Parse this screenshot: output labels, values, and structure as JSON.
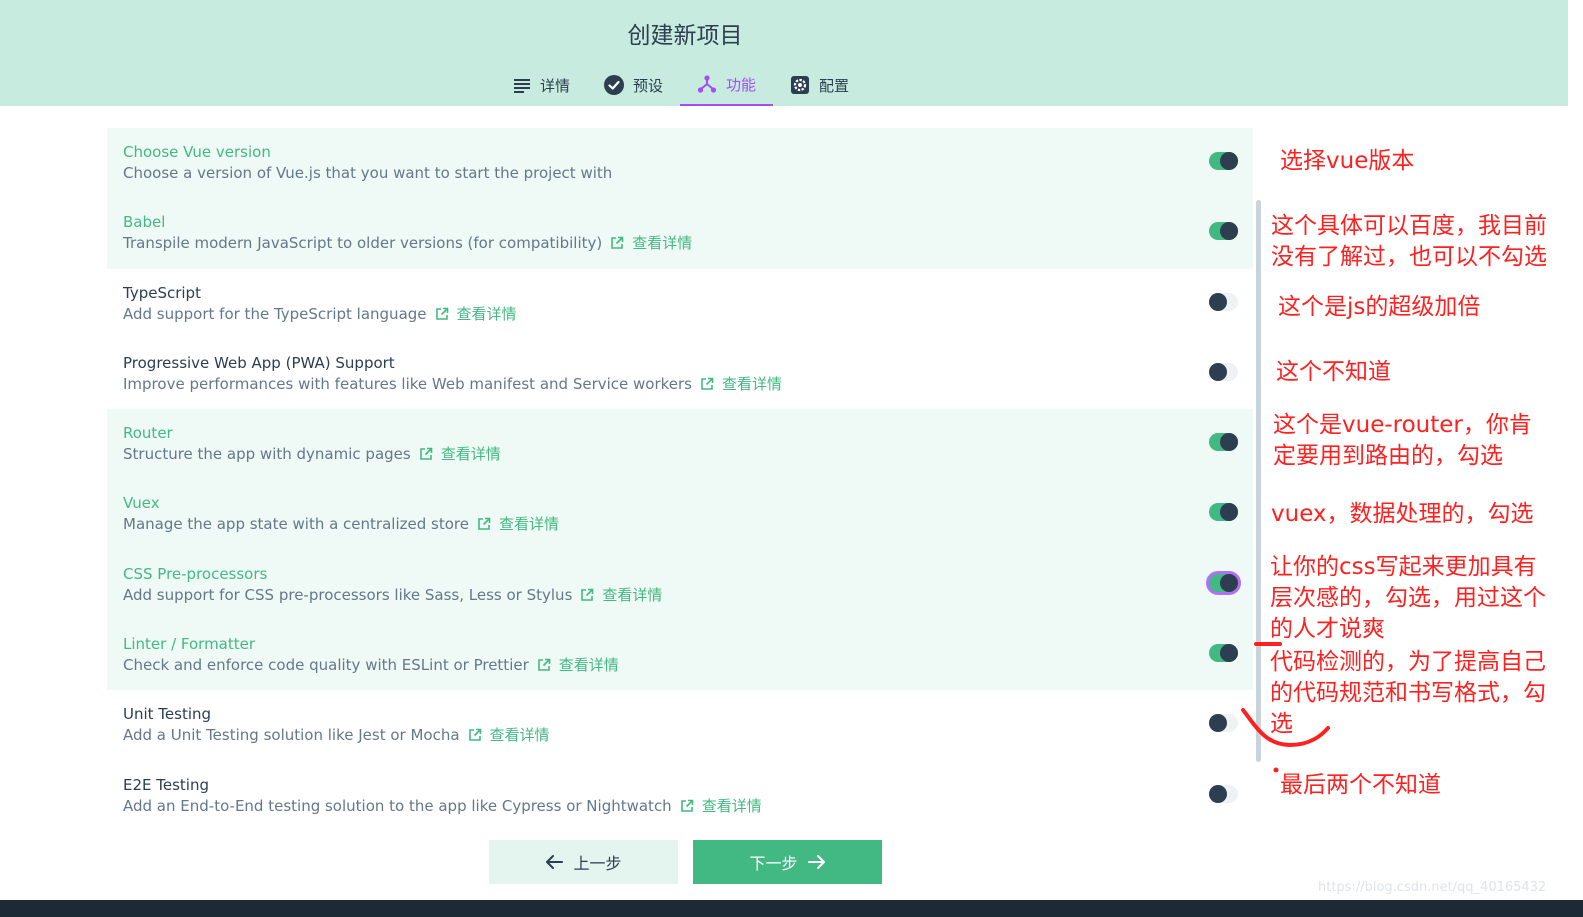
{
  "window": {
    "title": "创建新项目"
  },
  "tabs": [
    {
      "label": "详情",
      "icon": "list-icon",
      "active": false
    },
    {
      "label": "预设",
      "icon": "check-circle-icon",
      "active": false
    },
    {
      "label": "功能",
      "icon": "fork-icon",
      "active": true
    },
    {
      "label": "配置",
      "icon": "gear-icon",
      "active": false
    }
  ],
  "features": [
    {
      "title": "Choose Vue version",
      "desc": "Choose a version of Vue.js that you want to start the project with",
      "more": "",
      "enabled": true
    },
    {
      "title": "Babel",
      "desc": "Transpile modern JavaScript to older versions (for compatibility)",
      "more": "查看详情",
      "enabled": true
    },
    {
      "title": "TypeScript",
      "desc": "Add support for the TypeScript language",
      "more": "查看详情",
      "enabled": false
    },
    {
      "title": "Progressive Web App (PWA) Support",
      "desc": "Improve performances with features like Web manifest and Service workers",
      "more": "查看详情",
      "enabled": false
    },
    {
      "title": "Router",
      "desc": "Structure the app with dynamic pages",
      "more": "查看详情",
      "enabled": true
    },
    {
      "title": "Vuex",
      "desc": "Manage the app state with a centralized store",
      "more": "查看详情",
      "enabled": true
    },
    {
      "title": "CSS Pre-processors",
      "desc": "Add support for CSS pre-processors like Sass, Less or Stylus",
      "more": "查看详情",
      "enabled": true
    },
    {
      "title": "Linter / Formatter",
      "desc": "Check and enforce code quality with ESLint or Prettier",
      "more": "查看详情",
      "enabled": true
    },
    {
      "title": "Unit Testing",
      "desc": "Add a Unit Testing solution like Jest or Mocha",
      "more": "查看详情",
      "enabled": false
    },
    {
      "title": "E2E Testing",
      "desc": "Add an End-to-End testing solution to the app like Cypress or Nightwatch",
      "more": "查看详情",
      "enabled": false
    }
  ],
  "buttons": {
    "prev": "上一步",
    "next": "下一步"
  },
  "annotations": [
    {
      "lines": [
        "选择vue版本"
      ]
    },
    {
      "lines": [
        "这个具体可以百度，我目前",
        "没有了解过，也可以不勾选"
      ]
    },
    {
      "lines": [
        "这个是js的超级加倍"
      ]
    },
    {
      "lines": [
        "这个不知道"
      ]
    },
    {
      "lines": [
        "这个是vue-router，你肯",
        "定要用到路由的，勾选"
      ]
    },
    {
      "lines": [
        "vuex，数据处理的，勾选"
      ]
    },
    {
      "lines": [
        "让你的css写起来更加具有",
        "层次感的，勾选，用过这个",
        "的人才说爽"
      ]
    },
    {
      "lines": [
        "代码检测的，为了提高自己",
        "的代码规范和书写格式，勾",
        "选"
      ]
    },
    {
      "lines": [
        "最后两个不知道"
      ]
    }
  ],
  "watermark": "https://blog.csdn.net/qq_40165432",
  "colors": {
    "accent": "#42b983",
    "active_tab": "#a44cf6",
    "annotation": "#ff2020",
    "header_bg": "#c8ebdf"
  }
}
